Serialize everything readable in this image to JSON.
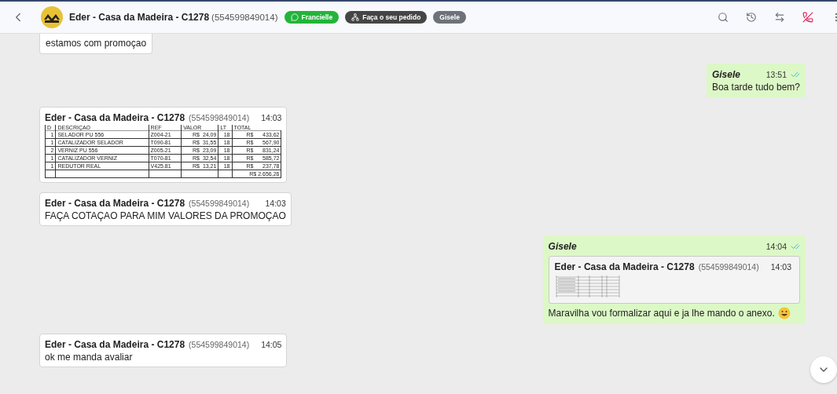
{
  "header": {
    "title": "Eder - Casa da Madeira - C1278",
    "phone": "(554599849014)",
    "tags": [
      {
        "label": "Francielle",
        "kind": "whatsapp"
      },
      {
        "label": "Faça o seu pedido",
        "kind": "flow"
      },
      {
        "label": "Gisele",
        "kind": "agent"
      }
    ]
  },
  "messages": [
    {
      "kind": "text",
      "outgoing": false,
      "cut": true,
      "text": "estamos com promoçao"
    },
    {
      "kind": "text",
      "outgoing": true,
      "sender": "Gisele",
      "time": "13:51",
      "read": true,
      "text": "Boa tarde tudo bem?"
    },
    {
      "kind": "table",
      "outgoing": false,
      "sender": "Eder - Casa da Madeira - C1278",
      "phone": "(554599849014)",
      "time": "14:03",
      "table": {
        "columns": [
          "D",
          "DESCRIÇAO",
          "REF",
          "VALOR",
          "LT",
          "TOTAL"
        ],
        "rows": [
          [
            "1",
            "SELADOR PU 556",
            "Z004-21",
            "R$  24,09",
            "18",
            "R$      433,62"
          ],
          [
            "1",
            "CATALIZADOR SELADOR",
            "T090-81",
            "R$  31,55",
            "18",
            "R$      567,90"
          ],
          [
            "2",
            "VERNIZ PU 556",
            "Z005-21",
            "R$  23,09",
            "18",
            "R$      831,24"
          ],
          [
            "1",
            "CATALIZADOR VERNIZ",
            "T070-81",
            "R$  32,54",
            "18",
            "R$      585,72"
          ],
          [
            "1",
            "REDUTOR REAL",
            "V425.81",
            "R$  13,21",
            "18",
            "R$      237,78"
          ],
          [
            "",
            "",
            "",
            "",
            "",
            "R$ 2.656,26"
          ]
        ]
      }
    },
    {
      "kind": "text",
      "sender": "Eder - Casa da Madeira - C1278",
      "phone": "(554599849014)",
      "time": "14:03",
      "outgoing": false,
      "text": "FAÇA COTAÇAO PARA MIM VALORES DA PROMOÇAO"
    },
    {
      "kind": "reply",
      "outgoing": true,
      "sender": "Gisele",
      "time": "14:04",
      "read": true,
      "quote": {
        "sender": "Eder - Casa da Madeira - C1278",
        "phone": "(554599849014)",
        "time": "14:03"
      },
      "text": "Maravilha vou formalizar aqui e ja lhe mando o anexo.",
      "emoji": true
    },
    {
      "kind": "text",
      "outgoing": false,
      "sender": "Eder - Casa da Madeira - C1278",
      "phone": "(554599849014)",
      "time": "14:05",
      "text": "ok me manda avaliar"
    }
  ]
}
